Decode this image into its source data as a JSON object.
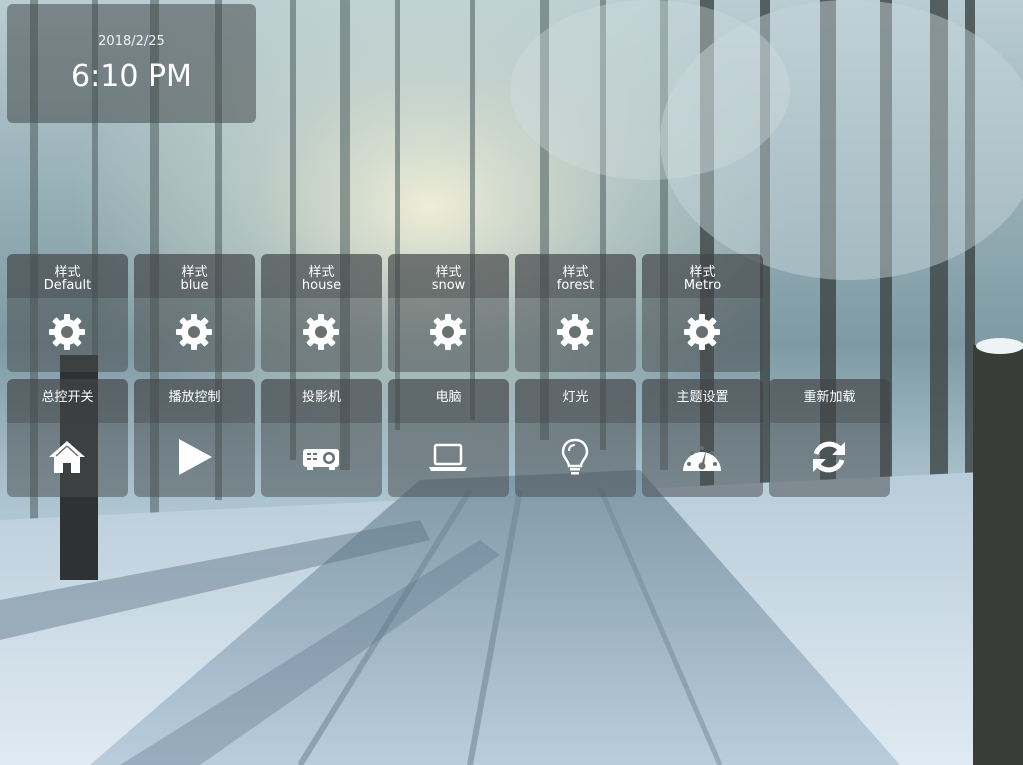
{
  "clock": {
    "date": "2018/2/25",
    "time": "6:10 PM"
  },
  "themes": [
    {
      "label_top": "样式",
      "label_bottom": "Default",
      "icon": "gear-icon"
    },
    {
      "label_top": "样式",
      "label_bottom": "blue",
      "icon": "gear-icon"
    },
    {
      "label_top": "样式",
      "label_bottom": "house",
      "icon": "gear-icon"
    },
    {
      "label_top": "样式",
      "label_bottom": "snow",
      "icon": "gear-icon"
    },
    {
      "label_top": "样式",
      "label_bottom": "forest",
      "icon": "gear-icon"
    },
    {
      "label_top": "样式",
      "label_bottom": "Metro",
      "icon": "gear-icon"
    }
  ],
  "functions": [
    {
      "label": "总控开关",
      "icon": "home-icon"
    },
    {
      "label": "播放控制",
      "icon": "play-icon"
    },
    {
      "label": "投影机",
      "icon": "projector-icon"
    },
    {
      "label": "电脑",
      "icon": "laptop-icon"
    },
    {
      "label": "灯光",
      "icon": "lightbulb-icon"
    },
    {
      "label": "主题设置",
      "icon": "dashboard-icon"
    },
    {
      "label": "重新加载",
      "icon": "reload-icon"
    }
  ],
  "colors": {
    "tile_background": "#484c4e",
    "text": "#ffffff"
  }
}
